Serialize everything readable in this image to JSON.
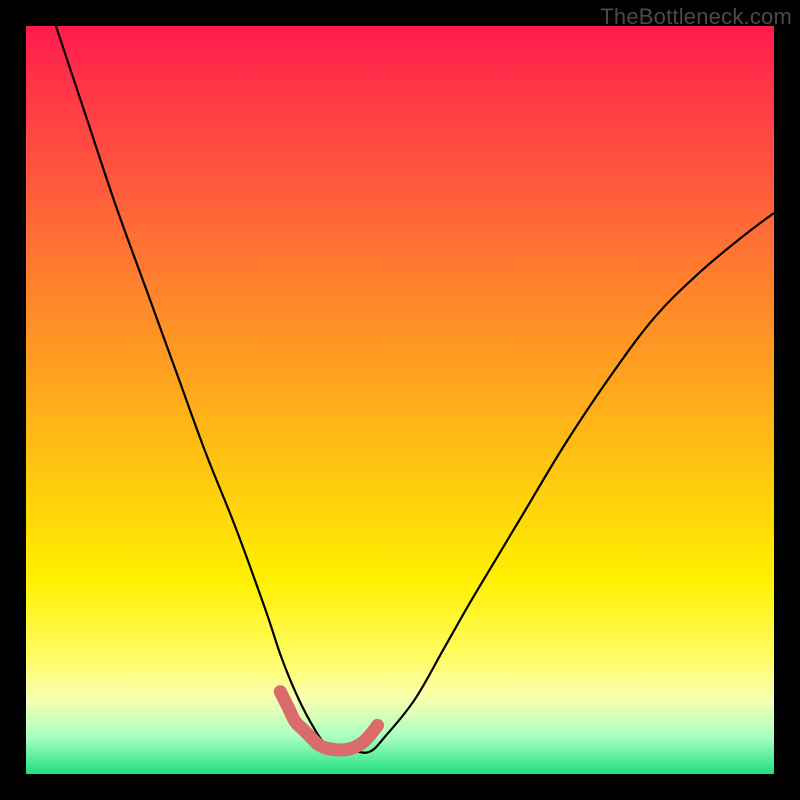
{
  "watermark": "TheBottleneck.com",
  "colors": {
    "background": "#000000",
    "curve_stroke": "#000000",
    "marker_stroke": "#d96b6b",
    "gradient_top": "#ff1a4d",
    "gradient_bottom": "#20e080"
  },
  "chart_data": {
    "type": "line",
    "title": "",
    "xlabel": "",
    "ylabel": "",
    "xlim": [
      0,
      100
    ],
    "ylim": [
      0,
      100
    ],
    "note": "V-shaped bottleneck curve. y ≈ 100 means maximum bottleneck (top/red), y ≈ 0 means no bottleneck (bottom/green). x is a normalized hardware balance axis. Values estimated from pixel positions; no numeric axes in source image.",
    "series": [
      {
        "name": "bottleneck-curve",
        "x": [
          4,
          8,
          12,
          16,
          20,
          24,
          28,
          32,
          34,
          36,
          38,
          40,
          42,
          44,
          46,
          48,
          52,
          56,
          60,
          66,
          72,
          78,
          84,
          90,
          96,
          100
        ],
        "y": [
          100,
          88,
          76,
          65,
          54,
          43,
          33,
          22,
          16,
          11,
          7,
          4,
          3,
          3,
          3,
          5,
          10,
          17,
          24,
          34,
          44,
          53,
          61,
          67,
          72,
          75
        ]
      },
      {
        "name": "highlight-segment",
        "x": [
          34,
          35,
          36,
          37,
          38,
          39,
          40,
          41,
          42,
          43,
          44,
          45,
          46,
          47
        ],
        "y": [
          11,
          9,
          7,
          6,
          5,
          4,
          3.5,
          3.3,
          3.2,
          3.3,
          3.6,
          4.2,
          5.2,
          6.5
        ]
      }
    ]
  }
}
